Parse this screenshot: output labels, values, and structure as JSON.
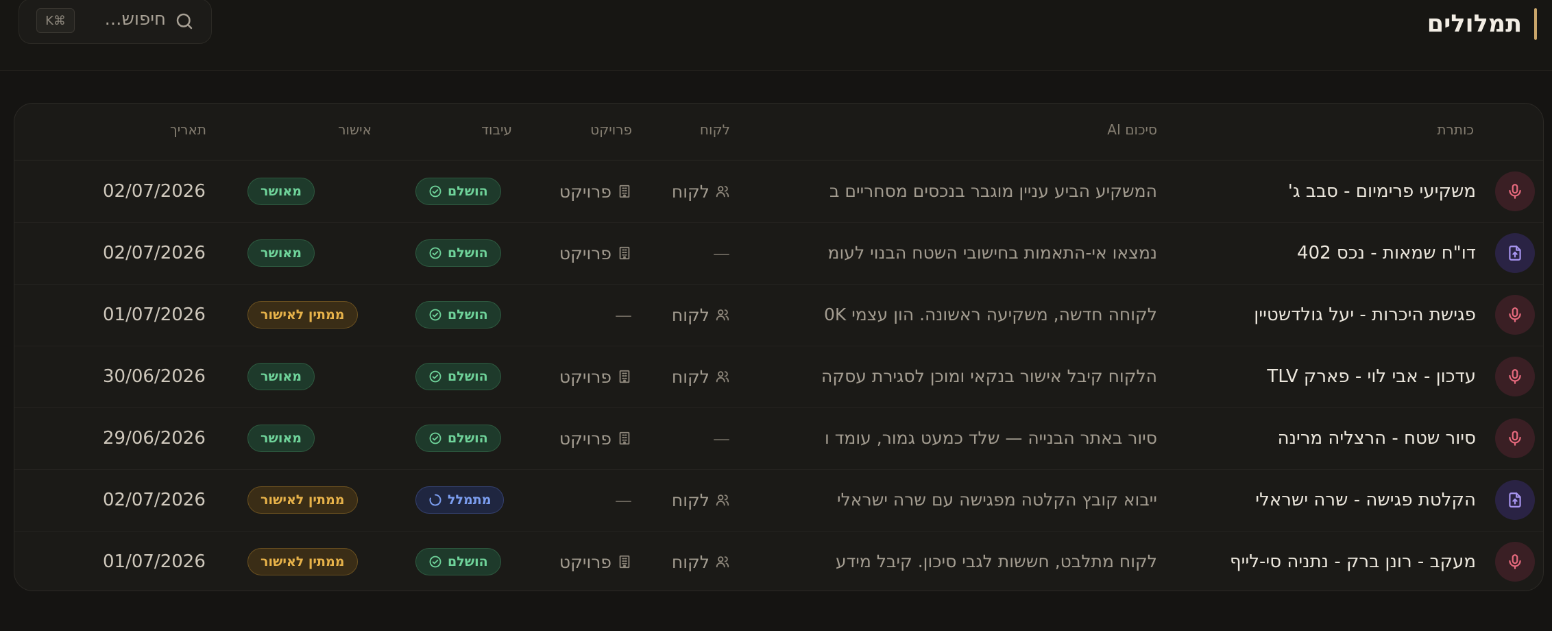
{
  "header": {
    "title": "תמלולים",
    "search_placeholder": "חיפוש...",
    "search_shortcut": "K⌘"
  },
  "columns": {
    "title": "כותרת",
    "summary": "סיכום AI",
    "client": "לקוח",
    "project": "פרויקט",
    "processing": "עיבוד",
    "approval": "אישור",
    "date": "תאריך"
  },
  "rows": [
    {
      "type": "audio",
      "title": "משקיעי פרימיום - סבב ג'",
      "summary": "המשקיע הביע עניין מוגבר בנכסים מסחריים ב",
      "client": "לקוח",
      "project": "פרויקט",
      "processing": "הושלם",
      "approval": "מאושר",
      "date": "02/07/2026"
    },
    {
      "type": "file",
      "title": "דו\"ח שמאות - נכס 402",
      "summary": "נמצאו אי-התאמות בחישובי השטח הבנוי לעומ",
      "client": "—",
      "project": "פרויקט",
      "processing": "הושלם",
      "approval": "מאושר",
      "date": "02/07/2026"
    },
    {
      "type": "audio",
      "title": "פגישת היכרות - יעל גולדשטיין",
      "summary": "לקוחה חדשה, משקיעה ראשונה. הון עצמי 0K",
      "client": "לקוח",
      "project": "—",
      "processing": "הושלם",
      "approval": "ממתין לאישור",
      "date": "01/07/2026"
    },
    {
      "type": "audio",
      "title": "עדכון - אבי לוי - פארק TLV",
      "summary": "הלקוח קיבל אישור בנקאי ומוכן לסגירת עסקה",
      "client": "לקוח",
      "project": "פרויקט",
      "processing": "הושלם",
      "approval": "מאושר",
      "date": "30/06/2026"
    },
    {
      "type": "audio",
      "title": "סיור שטח - הרצליה מרינה",
      "summary": "סיור באתר הבנייה — שלד כמעט גמור, עומד ו",
      "client": "—",
      "project": "פרויקט",
      "processing": "הושלם",
      "approval": "מאושר",
      "date": "29/06/2026"
    },
    {
      "type": "file",
      "title": "הקלטת פגישה - שרה ישראלי",
      "summary": "ייבוא קובץ הקלטה מפגישה עם שרה ישראלי",
      "client": "לקוח",
      "project": "—",
      "processing": "מתמלל",
      "approval": "ממתין לאישור",
      "date": "02/07/2026"
    },
    {
      "type": "audio",
      "title": "מעקב - רונן ברק - נתניה סי-לייף",
      "summary": "לקוח מתלבט, חששות לגבי סיכון. קיבל מידע",
      "client": "לקוח",
      "project": "פרויקט",
      "processing": "הושלם",
      "approval": "ממתין לאישור",
      "date": "01/07/2026"
    }
  ],
  "colors": {
    "approved": "#6fd39a",
    "pending": "#e8b34a",
    "transcribing": "#7c9ef0",
    "accent": "#c9a56a"
  }
}
